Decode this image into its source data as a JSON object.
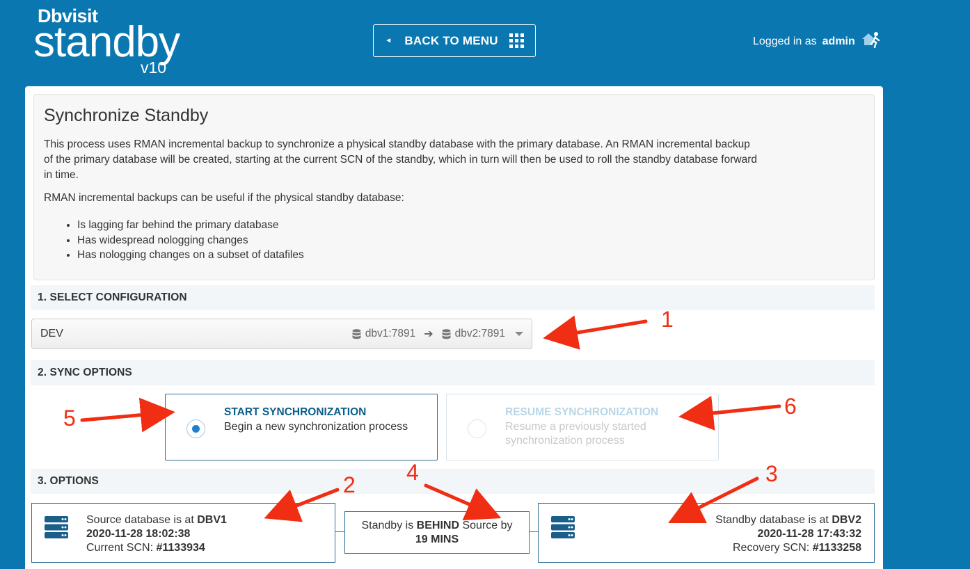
{
  "header": {
    "brand": "Dbvisit",
    "product": "standby",
    "version": "v10",
    "back_button_label": "BACK TO MENU",
    "login_prefix": "Logged in as",
    "login_user": "admin"
  },
  "intro": {
    "title": "Synchronize Standby",
    "paragraph_1": "This process uses RMAN incremental backup to synchronize a physical standby database with the primary database. An RMAN incremental backup of the primary database will be created, starting at the current SCN of the standby, which in turn will then be used to roll the standby database forward in time.",
    "paragraph_2": "RMAN incremental backups can be useful if the physical standby database:",
    "bullets": [
      "Is lagging far behind the primary database",
      "Has widespread nologging changes",
      "Has nologging changes on a subset of datafiles"
    ]
  },
  "sections": {
    "select_configuration": "1. SELECT CONFIGURATION",
    "sync_options": "2. SYNC OPTIONS",
    "options": "3. OPTIONS"
  },
  "configuration": {
    "name": "DEV",
    "source": "dbv1:7891",
    "target": "dbv2:7891"
  },
  "sync_options": [
    {
      "title": "START SYNCHRONIZATION",
      "description": "Begin a new synchronization process",
      "selected": true,
      "enabled": true
    },
    {
      "title": "RESUME SYNCHRONIZATION",
      "description": "Resume a previously started synchronization process",
      "selected": false,
      "enabled": false
    }
  ],
  "source_db": {
    "label": "Source database is at",
    "name": "DBV1",
    "timestamp": "2020-11-28 18:02:38",
    "scn_label": "Current SCN:",
    "scn": "#1133934"
  },
  "status": {
    "prefix": "Standby is",
    "state": "BEHIND",
    "suffix": "Source by",
    "lag": "19 MINS"
  },
  "standby_db": {
    "label": "Standby database is at",
    "name": "DBV2",
    "timestamp": "2020-11-28 17:43:32",
    "scn_label": "Recovery SCN:",
    "scn": "#1133258"
  },
  "annotations": [
    "1",
    "2",
    "3",
    "4",
    "5",
    "6"
  ],
  "colors": {
    "header_bg": "#0a77b1",
    "accent": "#0a5f8a",
    "radio_selected": "#1e7fd0",
    "annotation": "#ef2e14"
  }
}
